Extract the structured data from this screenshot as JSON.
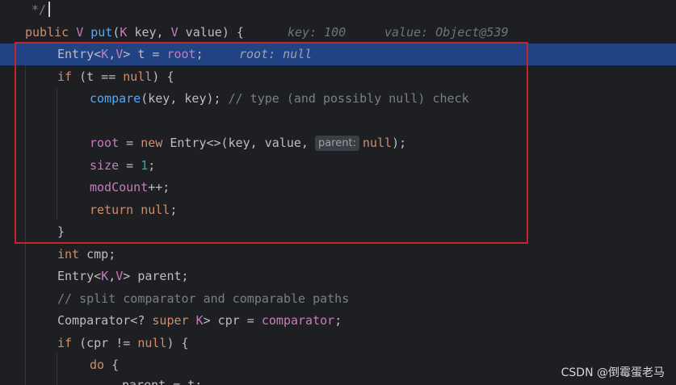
{
  "editor": {
    "lines": {
      "l00": {
        "text": "*/"
      },
      "l01": {
        "t1": "public ",
        "t2": "V ",
        "t3": "put",
        "t4": "(",
        "t5": "K",
        "t6": " key, ",
        "t7": "V",
        "t8": " value) {",
        "hint1": "key: 100",
        "hint2": "value: Object@539"
      },
      "l02": {
        "t1": "Entry<",
        "t2": "K",
        "t3": ",",
        "t4": "V",
        "t5": "> t = ",
        "t6": "root",
        "t7": ";",
        "hint1": "root: null"
      },
      "l03": {
        "t1": "if",
        "t2": " (t == ",
        "t3": "null",
        "t4": ") {"
      },
      "l04": {
        "t1": "compare",
        "t2": "(key, key); ",
        "t3": "// type (and possibly null) check"
      },
      "l06": {
        "t1": "root",
        "t2": " = ",
        "t3": "new",
        "t4": " Entry<>(key, value,",
        "chip": "parent:",
        "t5": "null",
        "t6": ");"
      },
      "l07": {
        "t1": "size",
        "t2": " = ",
        "t3": "1",
        "t4": ";"
      },
      "l08": {
        "t1": "modCount",
        "t2": "++;"
      },
      "l09": {
        "t1": "return",
        "t2": " ",
        "t3": "null",
        "t4": ";"
      },
      "l10": {
        "t1": "}"
      },
      "l11": {
        "t1": "int",
        "t2": " cmp;"
      },
      "l12": {
        "t1": "Entry<",
        "t2": "K",
        "t3": ",",
        "t4": "V",
        "t5": "> parent;"
      },
      "l13": {
        "t1": "// split comparator and comparable paths"
      },
      "l14": {
        "t1": "Comparator<? ",
        "t2": "super",
        "t3": " ",
        "t4": "K",
        "t5": "> cpr = ",
        "t6": "comparator",
        "t7": ";"
      },
      "l15": {
        "t1": "if",
        "t2": " (cpr != ",
        "t3": "null",
        "t4": ") {"
      },
      "l16": {
        "t1": "do",
        "t2": " {"
      },
      "l17": {
        "t1": "parent = t;"
      }
    }
  },
  "watermark": "CSDN @倒霉蛋老马"
}
